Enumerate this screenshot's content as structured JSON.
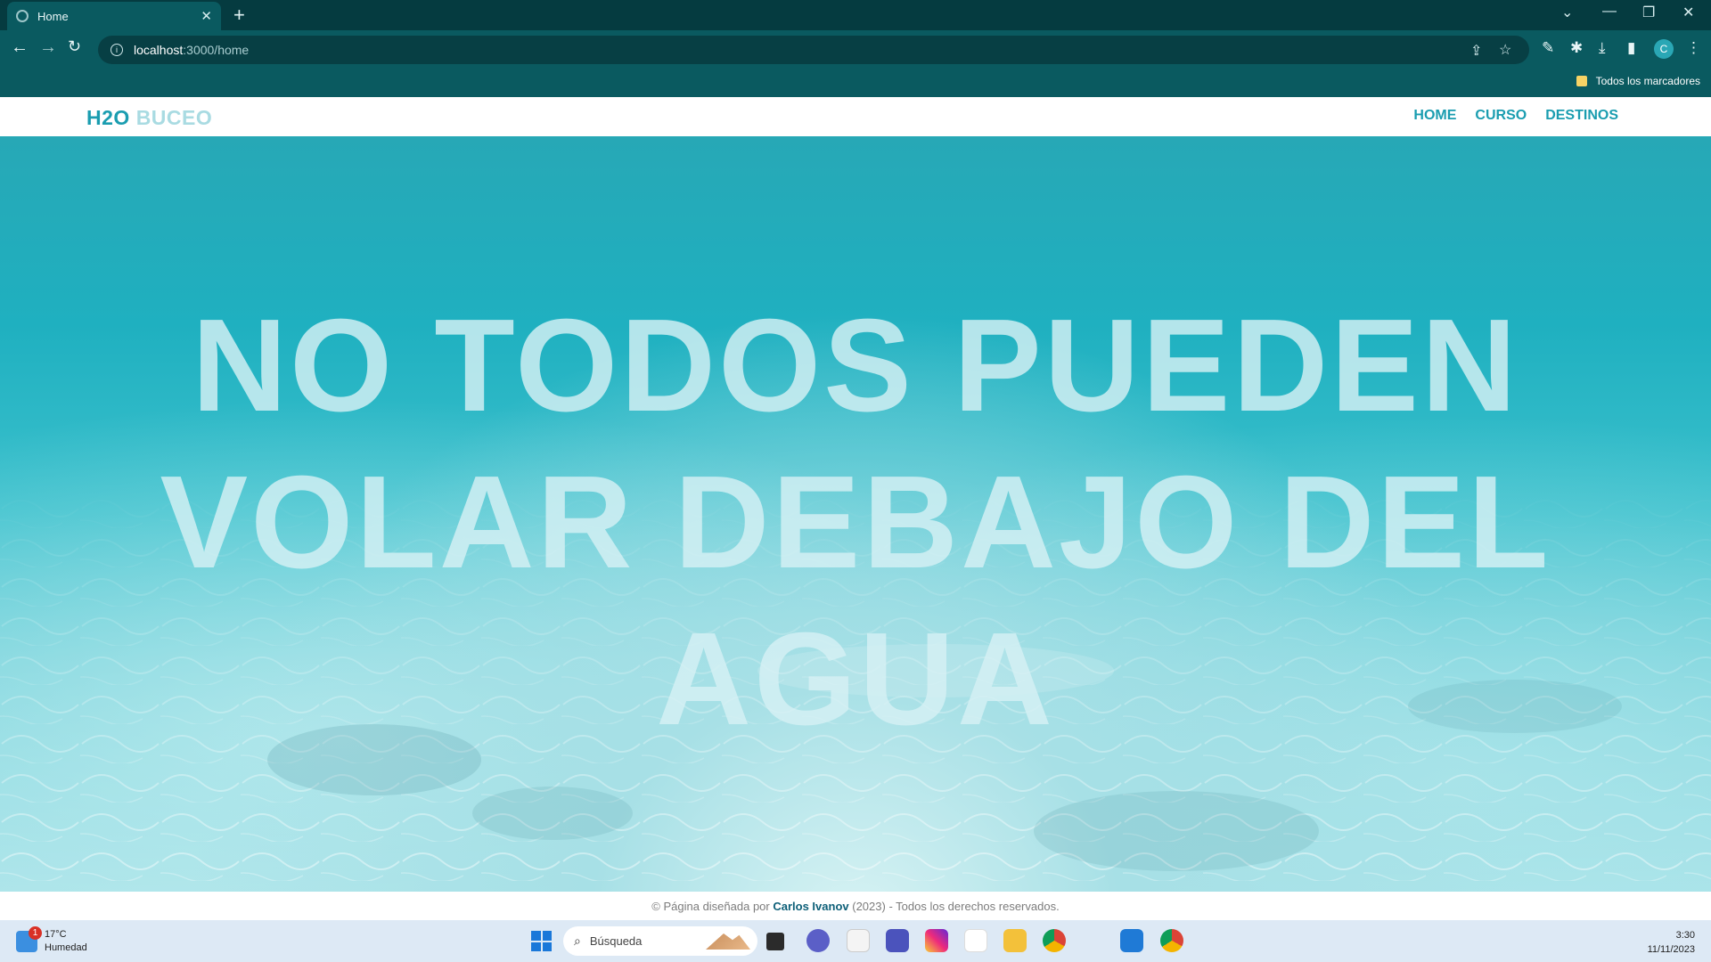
{
  "browser": {
    "tab_title": "Home",
    "url_host": "localhost",
    "url_path": ":3000/home",
    "bookmark_folder": "Todos los marcadores",
    "profile_initial": "C"
  },
  "site": {
    "logo_part1": "H2O",
    "logo_part2": "BUCEO",
    "nav": [
      "HOME",
      "CURSO",
      "DESTINOS"
    ],
    "hero_lines": [
      "NO TODOS PUEDEN",
      "VOLAR DEBAJO DEL",
      "AGUA"
    ],
    "footer_prefix": "© Página diseñada por",
    "footer_author": "Carlos Ivanov",
    "footer_suffix": "(2023) - Todos los derechos reservados."
  },
  "taskbar": {
    "weather_temp": "17°C",
    "weather_desc": "Humedad",
    "weather_badge": "1",
    "search_placeholder": "Búsqueda",
    "time": "3:30",
    "date": "11/11/2023"
  },
  "colors": {
    "accent": "#1a9db0",
    "logo_light": "#a9dbe2",
    "chrome_dark": "#053b40",
    "chrome": "#0a5a60"
  }
}
